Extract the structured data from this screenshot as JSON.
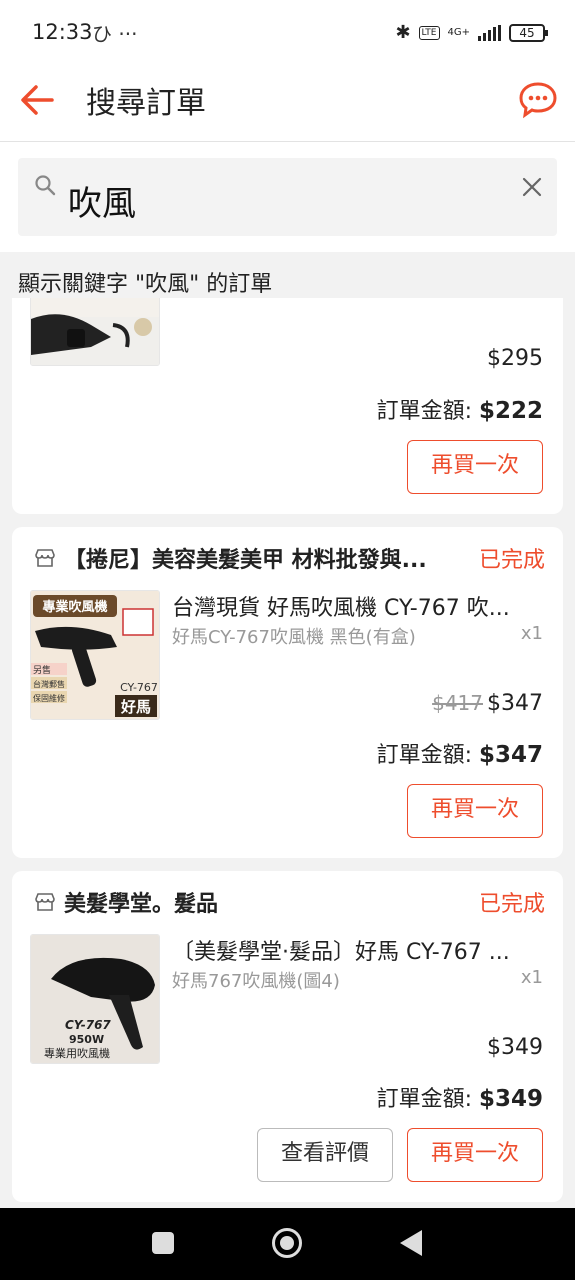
{
  "status_bar": {
    "time": "12:33",
    "left_icons": "ひ ···",
    "network": "4G+",
    "lte": "LTE",
    "battery": "45"
  },
  "header": {
    "title": "搜尋訂單"
  },
  "search": {
    "value": "吹風"
  },
  "result_label": "顯示關鍵字 \"吹風\" 的訂單",
  "orders": [
    {
      "price": "$295",
      "total_label": "訂單金額: ",
      "total": "$222",
      "buttons": [
        "再買一次"
      ]
    },
    {
      "shop": "【捲尼】美容美髮美甲 材料批發與...",
      "status": "已完成",
      "product": "台灣現貨 好馬吹風機 CY-767 吹...",
      "variant": "好馬CY-767吹風機 黑色(有盒)",
      "qty": "x1",
      "original_price": "$417",
      "price": "$347",
      "total_label": "訂單金額: ",
      "total": "$347",
      "buttons": [
        "再買一次"
      ],
      "thumb_text": {
        "banner": "專業吹風機",
        "tag1": "另售",
        "tag2": "台灣郵售",
        "tag3": "保固維修",
        "model": "CY-767",
        "brand": "好馬"
      }
    },
    {
      "shop": "美髮學堂。髮品",
      "status": "已完成",
      "product": "〔美髮學堂·髮品〕好馬 CY-767 ...",
      "variant": "好馬767吹風機(圖4)",
      "qty": "x1",
      "price": "$349",
      "total_label": "訂單金額: ",
      "total": "$349",
      "buttons": [
        "查看評價",
        "再買一次"
      ],
      "thumb_text": {
        "model": "CY-767",
        "watt": "950W",
        "caption": "專業用吹風機"
      }
    }
  ],
  "colors": {
    "accent": "#ee4d2d",
    "muted": "#999999"
  }
}
